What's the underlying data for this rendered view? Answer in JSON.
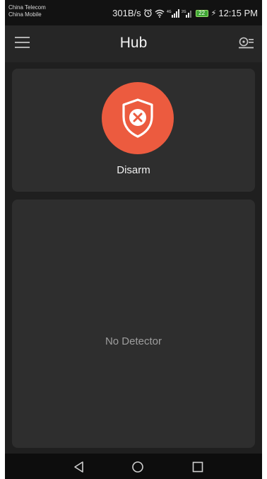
{
  "status_bar": {
    "carrier_1": "China Telecom",
    "carrier_2": "China Mobile",
    "network_speed": "301B/s",
    "battery_level": "22",
    "time": "12:15 PM",
    "icons": [
      "alarm-icon",
      "wifi-icon",
      "signal-icon",
      "signal-icon",
      "battery-icon"
    ]
  },
  "app_bar": {
    "title": "Hub",
    "left_icon": "menu-icon",
    "right_icon": "camera-settings-icon"
  },
  "arm_status": {
    "label": "Disarm",
    "icon": "shield-x-icon",
    "color": "#ec5b3f"
  },
  "detectors": {
    "empty_message": "No Detector"
  },
  "nav_bar": {
    "icons": [
      "back-icon",
      "home-icon",
      "recent-apps-icon"
    ]
  }
}
